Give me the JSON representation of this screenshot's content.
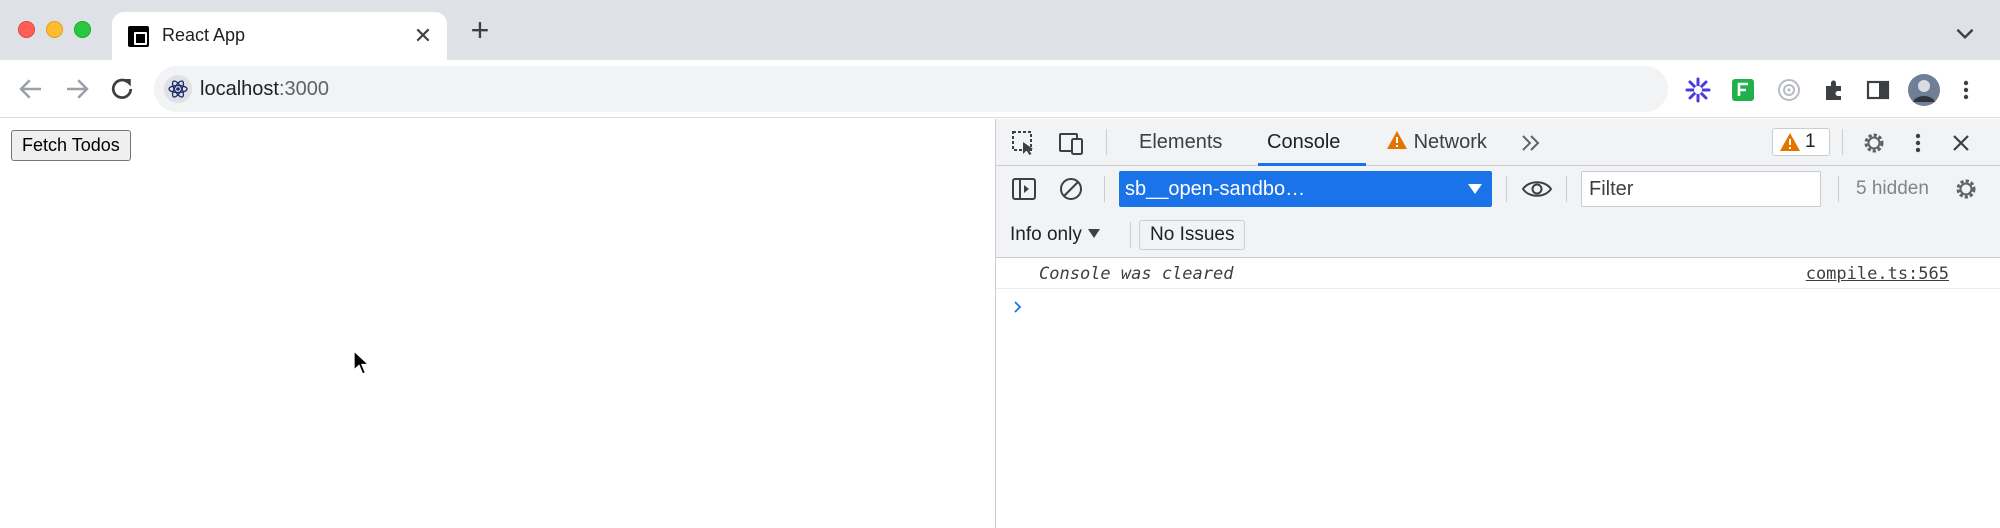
{
  "browser": {
    "tab_title": "React App",
    "tab_close_icon": "close-icon",
    "new_tab_icon": "plus-icon",
    "tab_search_icon": "chevron-down-icon",
    "address_host": "localhost",
    "address_port": ":3000",
    "extensions": [
      "starburst-extension-icon",
      "green-f-extension-icon",
      "target-extension-icon",
      "puzzle-extensions-icon",
      "side-panel-icon",
      "profile-avatar",
      "kebab-menu-icon"
    ]
  },
  "page": {
    "fetch_button_label": "Fetch Todos"
  },
  "devtools": {
    "tabs": [
      {
        "label": "Elements",
        "active": false
      },
      {
        "label": "Console",
        "active": true
      },
      {
        "label": "Network",
        "active": false,
        "warning": true
      }
    ],
    "more_tabs_icon": "double-chevron-right-icon",
    "warning_count": "1",
    "context_selector": "sb__open-sandbo…",
    "filter_placeholder": "Filter",
    "hidden_count": "5 hidden",
    "levels_label": "Info only",
    "issues_label": "No Issues",
    "messages": [
      {
        "text": "Console was cleared",
        "source": "compile.ts:565"
      }
    ],
    "accent_color": "#1a73e8",
    "warning_color": "#e37400"
  }
}
